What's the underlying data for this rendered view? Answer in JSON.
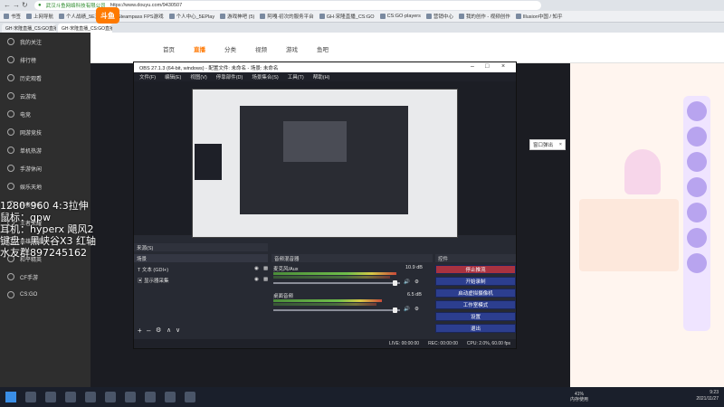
{
  "browser": {
    "url": "https://www.douyu.com/9430507",
    "site_label": "武汉斗鱼网络科技有限公司",
    "bookmarks": [
      "书签",
      "上网导航",
      "个人战绩_5E对战",
      "Steampass FPS游戏",
      "个人中心_5EPlay",
      "游戏神吧 (5)",
      "阿嘎·初次的服务平台",
      "GH·宋隆直播_CS:GO",
      "CS:GO·players",
      "营销中心",
      "我的创作 - 视频创作",
      "Illusion中国 / 知乎"
    ],
    "tabs": [
      {
        "label": "GH·宋隆直播_CS:GO直播_斗鱼",
        "active": false
      },
      {
        "label": "GH·宋隆直播_CS:GO直播_斗鱼直播",
        "active": true
      }
    ]
  },
  "site": {
    "logo": "斗鱼",
    "nav": [
      "首页",
      "直播",
      "分类",
      "视频",
      "游戏",
      "鱼吧"
    ],
    "active_nav": "直播",
    "left_nav": [
      "我的关注",
      "排行榜",
      "历史观看",
      "云游戏",
      "电竞",
      "网游竞技",
      "单机热游",
      "手游休闲",
      "娱乐天地",
      "科技文化",
      "王者荣耀",
      "英雄联盟",
      "和平精英",
      "CF手游",
      "CS:GO"
    ]
  },
  "stream_info": {
    "line1": "1280*960 4:3拉伸",
    "line2": "鼠标：gpw",
    "line3": "耳机：hyperx 飓风2",
    "line4": "键盘：黑峡谷X3 红轴",
    "line5": "水友群897245162"
  },
  "popup": {
    "label": "窗口弹出",
    "close": "×"
  },
  "obs": {
    "title": "OBS 27.1.3 (64-bit, windows) - 配置文件: 未命名 - 场景: 未命名",
    "menu": [
      "文件(F)",
      "编辑(E)",
      "视图(V)",
      "停靠部件(D)",
      "场景集合(S)",
      "工具(T)",
      "帮助(H)"
    ],
    "docks": {
      "scenes": "来源(S)",
      "sources": "场景",
      "mixer": "音频混音器",
      "controls": "控件"
    },
    "sources": [
      {
        "name": "文本 (GDI+)"
      },
      {
        "name": "显示器采集"
      }
    ],
    "mixer": [
      {
        "name": "麦克风/Aux",
        "db": "10.9 dB",
        "level": 0.82
      },
      {
        "name": "桌面音频",
        "db": "6.5 dB",
        "level": 0.72
      }
    ],
    "controls": [
      "停止推流",
      "开始录制",
      "启动虚拟摄像机",
      "工作室模式",
      "设置",
      "退出"
    ],
    "status": {
      "live": "LIVE: 00:00:00",
      "rec": "REC: 00:00:00",
      "cpu": "CPU: 2.0%, 60.00 fps"
    }
  },
  "taskbar": {
    "mem": "41%",
    "mem_label": "内存使用",
    "time": "9:23",
    "date": "2021/11/27"
  }
}
